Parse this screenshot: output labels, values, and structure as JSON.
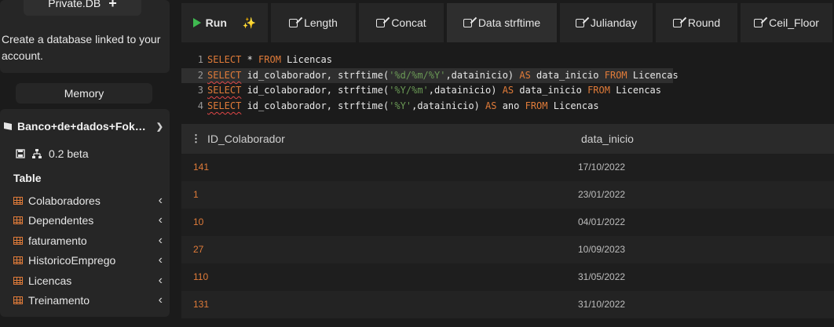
{
  "sidebar": {
    "private_db_label": "Private.DB",
    "private_db_description": "Create a database linked to your account.",
    "memory_label": "Memory",
    "database_name": "Banco+de+dados+Foku…",
    "version": "0.2 beta",
    "table_section_label": "Table",
    "tables": [
      {
        "name": "Colaboradores"
      },
      {
        "name": "Dependentes"
      },
      {
        "name": "faturamento"
      },
      {
        "name": "HistoricoEmprego"
      },
      {
        "name": "Licencas"
      },
      {
        "name": "Treinamento"
      }
    ]
  },
  "toolbar": {
    "run_label": "Run",
    "buttons": [
      "Length",
      "Concat",
      "Data strftime",
      "Julianday",
      "Round",
      "Ceil_Floor"
    ],
    "active_button": "Data strftime"
  },
  "editor": {
    "lines": [
      {
        "n": "1",
        "t1": "SELECT",
        "t2": " * ",
        "t3": "FROM",
        "t4": " Licencas"
      },
      {
        "n": "2",
        "t1": "SELECT",
        "t2": " id_colaborador, strftime(",
        "s": "'%d/%m/%Y'",
        "t3": ",datainicio) ",
        "k2": "AS",
        "t4": " data_inicio ",
        "k3": "FROM",
        "t5": " Licencas"
      },
      {
        "n": "3",
        "t1": "SELECT",
        "t2": " id_colaborador, strftime(",
        "s": "'%Y/%m'",
        "t3": ",datainicio) ",
        "k2": "AS",
        "t4": " data_inicio ",
        "k3": "FROM",
        "t5": " Licencas"
      },
      {
        "n": "4",
        "t1": "SELECT",
        "t2": " id_colaborador, strftime(",
        "s": "'%Y'",
        "t3": ",datainicio) ",
        "k2": "AS",
        "t4": " ano ",
        "k3": "FROM",
        "t5": " Licencas"
      }
    ]
  },
  "results": {
    "columns": [
      "ID_Colaborador",
      "data_inicio"
    ],
    "rows": [
      [
        "141",
        "17/10/2022"
      ],
      [
        "1",
        "23/01/2022"
      ],
      [
        "10",
        "04/01/2022"
      ],
      [
        "27",
        "10/09/2023"
      ],
      [
        "110",
        "31/05/2022"
      ],
      [
        "131",
        "31/10/2022"
      ]
    ]
  },
  "colors": {
    "accent": "#e07b39",
    "run_green": "#3fb950",
    "string_green": "#6a9955"
  }
}
